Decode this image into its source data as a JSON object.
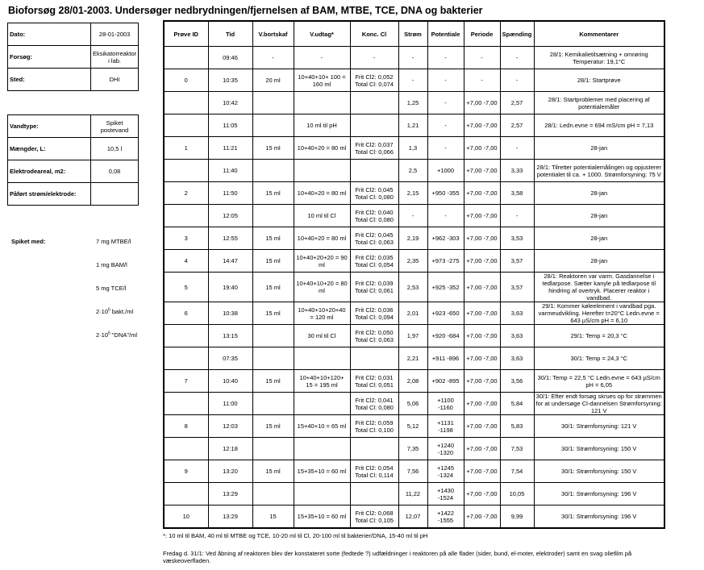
{
  "title": "Bioforsøg 28/01-2003. Undersøger nedbrydningen/fjernelsen af BAM, MTBE, TCE, DNA og bakterier",
  "info1": [
    {
      "label": "Dato:",
      "value": "28-01-2003"
    },
    {
      "label": "Forsøg:",
      "value": "Eksikatorreaktor i lab."
    },
    {
      "label": "Sted:",
      "value": "DHI"
    }
  ],
  "info2": [
    {
      "label": "Vandtype:",
      "value": "Spiket postevand"
    },
    {
      "label": "Mængder, L:",
      "value": "10,5 l"
    },
    {
      "label": "Elektrodeareal, m2:",
      "value": "0,08"
    },
    {
      "label": "Påført strøm/elektrode:",
      "value": ""
    }
  ],
  "spike": {
    "label": "Spiket med:",
    "items": [
      {
        "pre": "7 mg MTBE/l",
        "sup": "",
        "post": ""
      },
      {
        "pre": "1 mg BAM/l",
        "sup": "",
        "post": ""
      },
      {
        "pre": "5 mg TCE/l",
        "sup": "",
        "post": ""
      },
      {
        "pre": "2·10",
        "sup": "6",
        "post": " bakt./ml"
      },
      {
        "pre": "2·10",
        "sup": "6",
        "post": " \"DNA\"/ml"
      }
    ]
  },
  "headers": [
    "Prøve ID",
    "Tid",
    "V.bortskaf",
    "V.udtag*",
    "Konc. Cl",
    "Strøm",
    "Potentiale",
    "Periode",
    "Spænding",
    "Kommentarer"
  ],
  "rows": [
    [
      "",
      "09:46",
      "-",
      "-",
      "-",
      "-",
      "-",
      "-",
      "-",
      "28/1: Kemikalietilsætning + omrøring Temperatur: 19,1°C"
    ],
    [
      "0",
      "10:35",
      "20 ml",
      "10+40+10+ 100 = 160 ml",
      "Frit Cl2: 0,052 Total Cl: 0,074",
      "-",
      "-",
      "-",
      "-",
      "28/1: Startprøve"
    ],
    [
      "",
      "10:42",
      "",
      "",
      "",
      "1,25",
      "-",
      "+7,00 -7,00",
      "2,57",
      "28/1: Startproblemer med placering af potentialemåler"
    ],
    [
      "",
      "11:05",
      "",
      "10 ml til pH",
      "",
      "1,21",
      "-",
      "+7,00 -7,00",
      "2,57",
      "28/1: Ledn.evne = 694 mS/cm pH = 7,13"
    ],
    [
      "1",
      "11:21",
      "15 ml",
      "10+40+20 = 80 ml",
      "Frit Cl2: 0,037 Total Cl: 0,066",
      "1,3",
      "-",
      "+7,00 -7,00",
      "-",
      "28-jan"
    ],
    [
      "",
      "11:40",
      "",
      "",
      "",
      "2,5",
      "+1000",
      "+7,00 -7,00",
      "3,33",
      "28/1: Tilretter potentialemålingen og opjusterer potentialet til ca. + 1000. Strømforsyning: 75 V"
    ],
    [
      "2",
      "11:50",
      "15 ml",
      "10+40+20 = 80 ml",
      "Frit Cl2: 0,045 Total Cl: 0,080",
      "2,15",
      "+950 -355",
      "+7,00 -7,00",
      "3,58",
      "28-jan"
    ],
    [
      "",
      "12:05",
      "",
      "10 ml til Cl",
      "Frit Cl2: 0,040 Total Cl: 0,080",
      "-",
      "-",
      "+7,00 -7,00",
      "-",
      "28-jan"
    ],
    [
      "3",
      "12:55",
      "15 ml",
      "10+40+20 = 80 ml",
      "Frit Cl2: 0,045 Total Cl: 0,063",
      "2,19",
      "+962 -303",
      "+7,00 -7,00",
      "3,53",
      "28-jan"
    ],
    [
      "4",
      "14:47",
      "15 ml",
      "10+40+20+20 = 90 ml",
      "Frit Cl2: 0,035 Total Cl: 0,054",
      "2,35",
      "+973 -275",
      "+7,00 -7,00",
      "3,57",
      "28-jan"
    ],
    [
      "5",
      "19:40",
      "15 ml",
      "10+40+10+20 = 80 ml",
      "Frit Cl2: 0,039 Total Cl: 0,061",
      "2,53",
      "+925 -352",
      "+7,00 -7,00",
      "3,57",
      "28/1: Reaktoren var varm. Gasdannelse i tedlarpose. Sætter kanyle på tedlarpose til hindring af overtryk. Placerer reaktor i vandbad."
    ],
    [
      "6",
      "10:38",
      "15 ml",
      "10+40+10+20+40 = 120 ml",
      "Frit Cl2: 0,036 Total Cl: 0,094",
      "2,01",
      "+923 -650",
      "+7,00 -7,00",
      "3,63",
      "29/1: Kommer køleelement i vandbad pga. varmeudvikling. Herefter t=20°C Ledn.evne = 643 µS/cm pH = 6,10"
    ],
    [
      "",
      "13:15",
      "",
      "30 ml til Cl",
      "Frit Cl2: 0,050 Total Cl: 0,063",
      "1,97",
      "+920 -684",
      "+7,00 -7,00",
      "3,63",
      "29/1: Temp = 20,3 °C"
    ],
    [
      "",
      "07:35",
      "",
      "",
      "",
      "2,21",
      "+911 -896",
      "+7,00 -7,00",
      "3,63",
      "30/1: Temp = 24,3 °C"
    ],
    [
      "7",
      "10:40",
      "15 ml",
      "10+40+10+120+ 15 = 195 ml",
      "Frit Cl2: 0,031 Total Cl: 0,051",
      "2,08",
      "+902 -895",
      "+7,00 -7,00",
      "3,56",
      "30/1: Temp = 22,5 °C Ledn.evne = 643 µS/cm pH = 6,05"
    ],
    [
      "",
      "11:00",
      "",
      "",
      "Frit Cl2: 0,041 Total Cl: 0,080",
      "5,06",
      "+1100 -1160",
      "+7,00 -7,00",
      "5,84",
      "30/1: Efter endt forsøg skrues op for strømmen for at undersøge Cl-dannelsen Strømforsyning: 121 V"
    ],
    [
      "8",
      "12:03",
      "15 ml",
      "15+40+10 = 65 ml",
      "Frit Cl2: 0,059 Total Cl: 0,100",
      "5,12",
      "+1131 -1198",
      "+7,00 -7,00",
      "5,83",
      "30/1: Strømforsyning: 121 V"
    ],
    [
      "",
      "12:18",
      "",
      "",
      "",
      "7,35",
      "+1240 -1320",
      "+7,00 -7,00",
      "7,53",
      "30/1: Strømforsyning: 150 V"
    ],
    [
      "9",
      "13:20",
      "15 ml",
      "15+35+10 = 60 ml",
      "Frit Cl2: 0,054 Total Cl: 0,114",
      "7,56",
      "+1245 -1324",
      "+7,00 -7,00",
      "7,54",
      "30/1: Strømforsyning: 150 V"
    ],
    [
      "",
      "13:29",
      "",
      "",
      "",
      "11,22",
      "+1430 -1524",
      "+7,00 -7,00",
      "10,05",
      "30/1: Strømforsyning: 196 V"
    ],
    [
      "10",
      "13:29",
      "15",
      "15+35+10 = 60 ml",
      "Frit Cl2: 0,068 Total Cl: 0,105",
      "12,07",
      "+1422 -1555",
      "+7,00 -7,00",
      "9,99",
      "30/1: Strømforsyning: 196 V"
    ]
  ],
  "footnote1": "*: 10 ml til BAM, 40 ml til MTBE og TCE, 10-20 ml til Cl, 20-100 ml til bakterier/DNA, 15-40 ml til pH",
  "footnote2": "Fredag d. 31/1: Ved åbning af reaktoren blev der konstateret sorte (fedtede ?) udfældninger i reaktoren på alle flader (sider, bund, el-moter, elektroder) samt en svag oliefilm på væskeoverfladen."
}
